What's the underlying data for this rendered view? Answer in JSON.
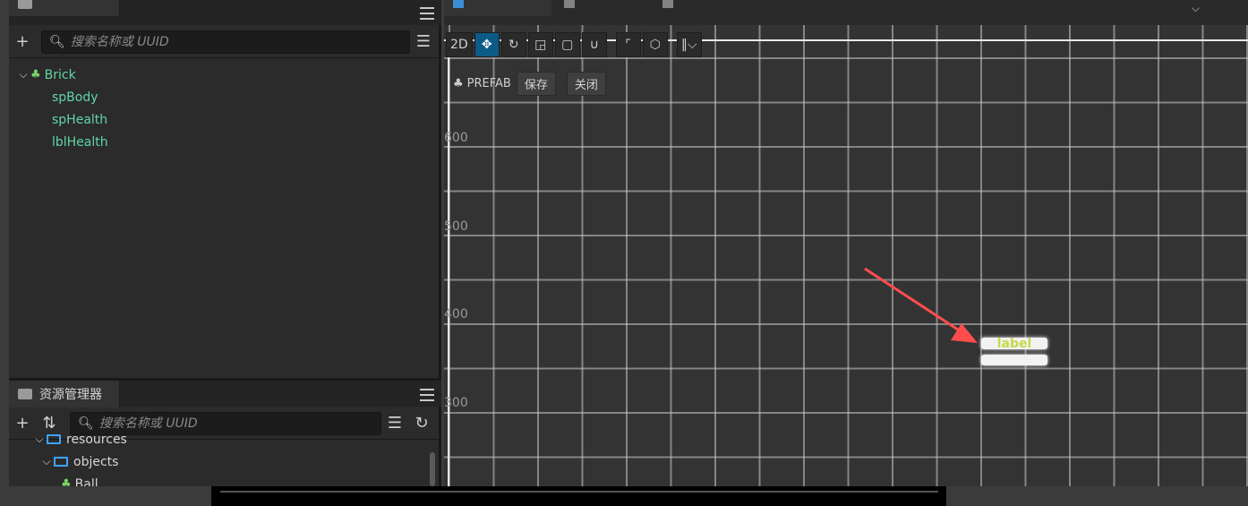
{
  "hierarchy": {
    "search_placeholder": "搜索名称或 UUID",
    "tree": [
      {
        "label": "Brick"
      },
      {
        "label": "spBody"
      },
      {
        "label": "spHealth"
      },
      {
        "label": "lblHealth"
      }
    ]
  },
  "assets": {
    "tab_label": "资源管理器",
    "search_placeholder": "搜索名称或 UUID",
    "tree": [
      {
        "label": "resources"
      },
      {
        "label": "objects"
      },
      {
        "label": "Ball"
      }
    ]
  },
  "scene": {
    "toolbar": {
      "mode_2d": "2D"
    },
    "prefab": {
      "tag": "PREFAB",
      "save": "保存",
      "close": "关闭"
    },
    "y_axis_labels": [
      "600",
      "500",
      "400",
      "300"
    ],
    "node_label": "label"
  },
  "colors": {
    "node_green": "#5fd6a8",
    "accent_blue": "#3fa3ff",
    "arrow_red": "#ff4d4d",
    "label_yellow": "#c8d84a"
  }
}
